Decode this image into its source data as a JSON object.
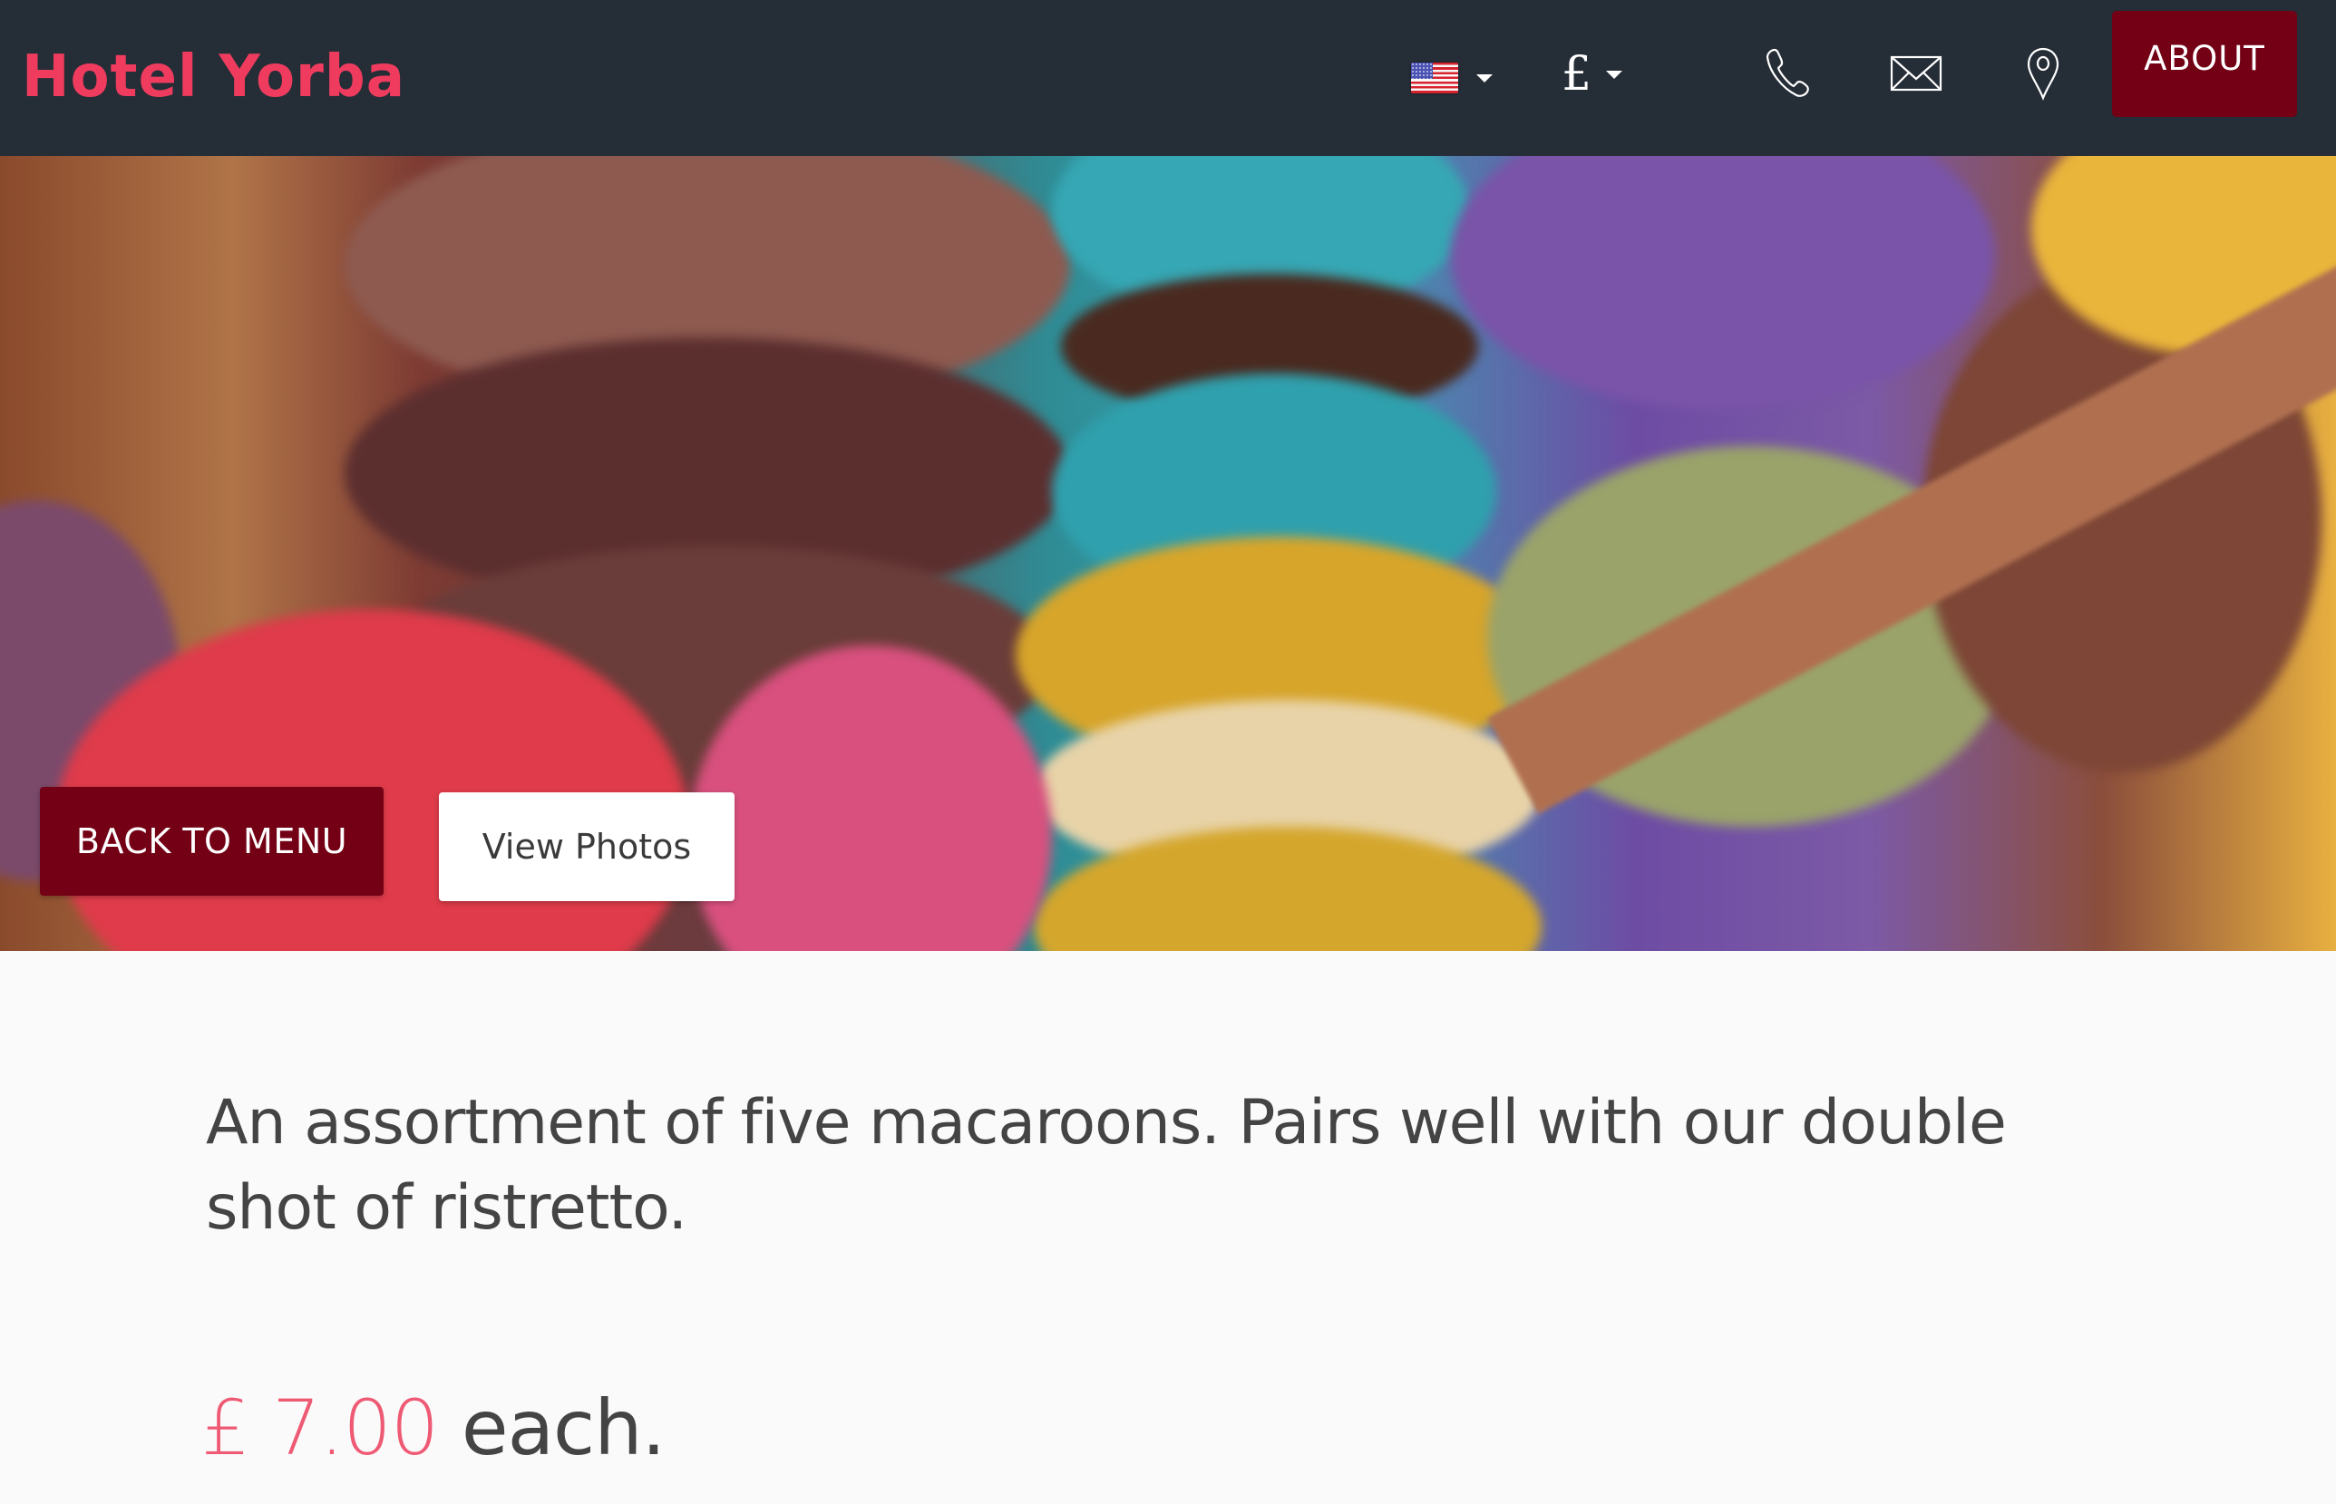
{
  "header": {
    "logo": "Hotel Yorba",
    "language": {
      "selected": "en-US",
      "icon": "us-flag-icon"
    },
    "currency": {
      "selected": "£"
    },
    "icons": [
      "phone-icon",
      "mail-icon",
      "location-pin-icon"
    ],
    "about_label": "ABOUT"
  },
  "hero": {
    "image_subject": "stacks of colorful macarons",
    "back_label": "BACK TO MENU",
    "photos_label": "View Photos"
  },
  "content": {
    "description": "An assortment of five macaroons. Pairs well with our double shot of ristretto.",
    "price": "£ 7.00",
    "price_suffix": "each."
  },
  "colors": {
    "header_bg": "#252d37",
    "brand": "#ef3c5e",
    "button_primary": "#730014",
    "price": "#ee5a74",
    "text": "#444444",
    "page_bg": "#fafafa"
  }
}
